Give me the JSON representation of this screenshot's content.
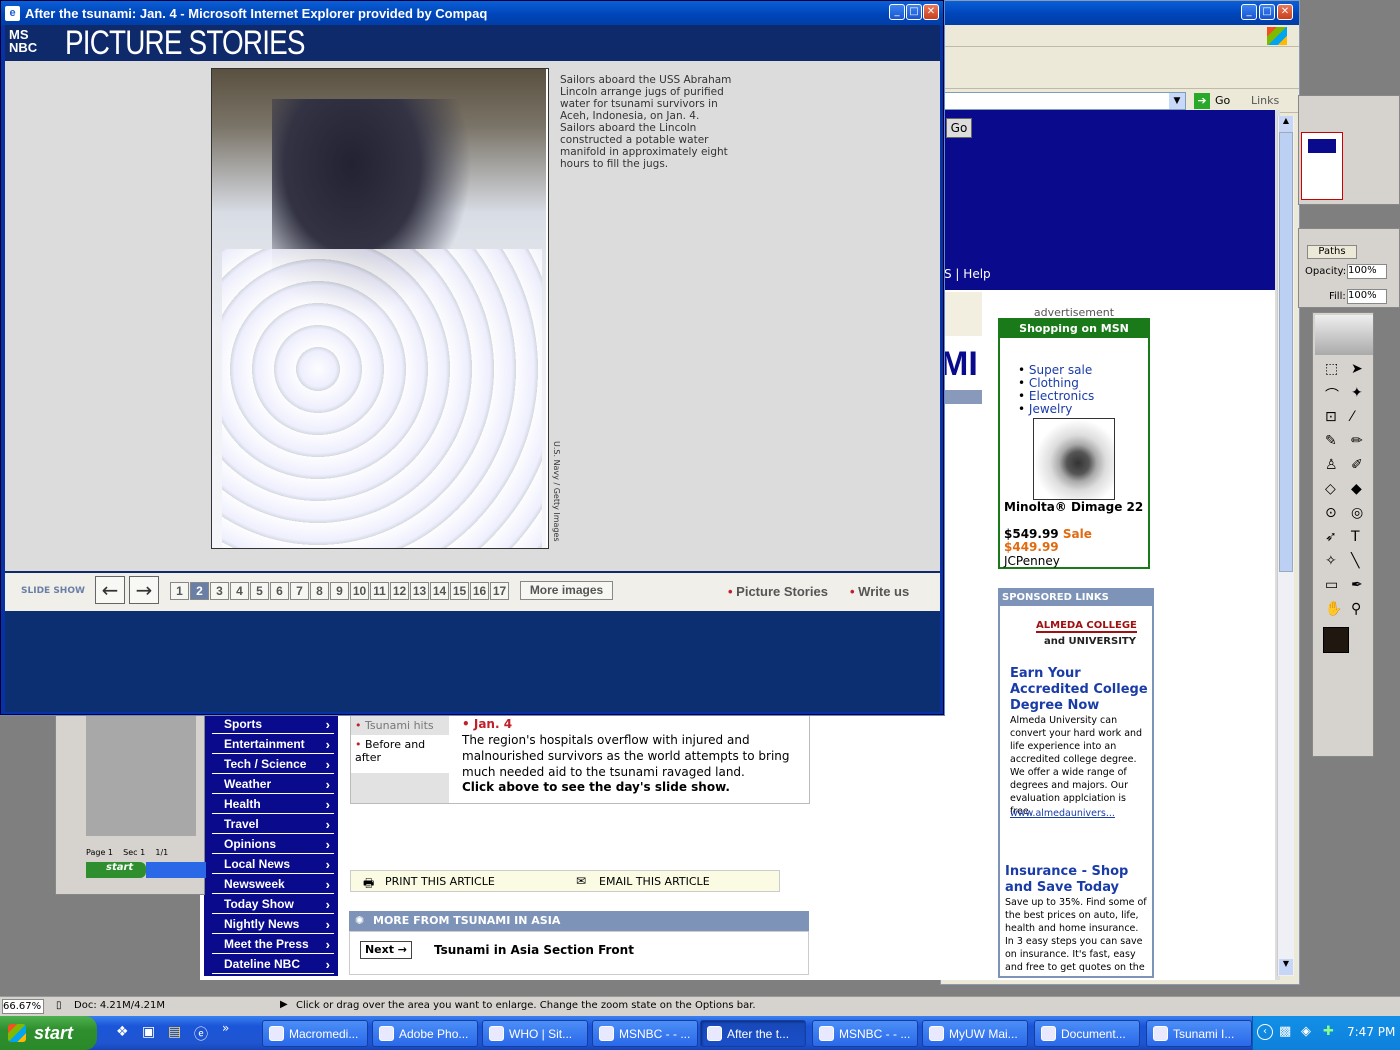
{
  "window": {
    "title": "After the tsunami: Jan. 4 - Microsoft Internet Explorer provided by Compaq"
  },
  "header": {
    "logo": "MS NBC",
    "title": "PICTURE STORIES"
  },
  "slide": {
    "caption": "Sailors aboard the USS Abraham Lincoln arrange jugs of purified water for tsunami survivors in Aceh, Indonesia, on Jan. 4.  Sailors aboard the Lincoln constructed a potable water manifold in approximately eight hours to fill the jugs.",
    "credit": "U.S. Navy / Getty Images"
  },
  "controls": {
    "slideshow_label": "SLIDE SHOW",
    "prev": "←",
    "next": "→",
    "pages": [
      "1",
      "2",
      "3",
      "4",
      "5",
      "6",
      "7",
      "8",
      "9",
      "10",
      "11",
      "12",
      "13",
      "14",
      "15",
      "16",
      "17"
    ],
    "active_page": "2",
    "more_images": "More images",
    "picture_stories": "Picture Stories",
    "write_us": "Write us"
  },
  "bg_page": {
    "go": "Go",
    "help": "S | Help",
    "nav": [
      "Sports",
      "Entertainment",
      "Tech / Science",
      "Weather",
      "Health",
      "Travel",
      "Opinions",
      "Local News",
      "Newsweek",
      "Today Show",
      "Nightly News",
      "Meet the Press",
      "Dateline NBC"
    ],
    "story_links": [
      "Tsunami hits",
      "Before and after"
    ],
    "date": "Jan. 4",
    "story_text": "The region's hospitals overflow with injured and malnourished survivors as the world attempts to bring much needed aid to the tsunami ravaged land.",
    "story_cta": "Click above to see the day's slide show.",
    "print": "PRINT THIS ARTICLE",
    "email": "EMAIL THIS ARTICLE",
    "more_from": "MORE FROM TSUNAMI IN ASIA",
    "next_btn": "Next →",
    "section_front": "Tsunami in Asia Section Front",
    "big_letters": "MI"
  },
  "ad": {
    "label": "advertisement",
    "title": "Shopping on MSN",
    "links": [
      "Super sale",
      "Clothing",
      "Electronics",
      "Jewelry"
    ],
    "product": "Minolta® Dimage 22",
    "price": "$549.99",
    "sale": "Sale",
    "sale_price": "$449.99",
    "store": "JCPenney"
  },
  "sponsored": {
    "header": "SPONSORED LINKS",
    "logo1": "ALMEDA COLLEGE",
    "logo2": "and UNIVERSITY",
    "ad1_title": "Earn Your Accredited College Degree Now",
    "ad1_text": "Almeda University can convert your hard work and life experience into an accredited college degree. We offer a wide range of degrees and majors. Our evaluation applciation is free.",
    "ad1_url": "www.almedaunivers...",
    "ad2_title": "Insurance - Shop and Save Today",
    "ad2_text": "Save up to 35%. Find some of the best prices on auto, life, health and home insurance. In 3 easy steps you can save on insurance. It's fast, easy and free to get quotes on the"
  },
  "back_window": {
    "links": "Links",
    "go": "Go"
  },
  "photoshop": {
    "paths_tab": "Paths",
    "opacity_label": "Opacity:",
    "opacity": "100%",
    "fill_label": "Fill:",
    "fill": "100%"
  },
  "mini_word": {
    "page": "Page 1",
    "sec": "Sec 1",
    "count": "1/1",
    "start": "start"
  },
  "statusbar": {
    "zoom": "66.67%",
    "doc": "Doc: 4.21M/4.21M",
    "hint": "Click or drag over the area you want to enlarge. Change the zoom state on the Options bar."
  },
  "taskbar": {
    "start": "start",
    "tasks": [
      "Macromedi...",
      "Adobe Pho...",
      "WHO | Sit...",
      "MSNBC - - ...",
      "After the t...",
      "MSNBC - - ...",
      "MyUW Mai...",
      "Document...",
      "Tsunami I..."
    ],
    "active": 4,
    "clock": "7:47 PM"
  },
  "colors": {
    "msnbc_blue": "#0e2a6a",
    "nav_blue": "#0a0a8c",
    "shop_green": "#1a7a1a",
    "sale_orange": "#e06a10",
    "bullet_red": "#c0202a"
  }
}
